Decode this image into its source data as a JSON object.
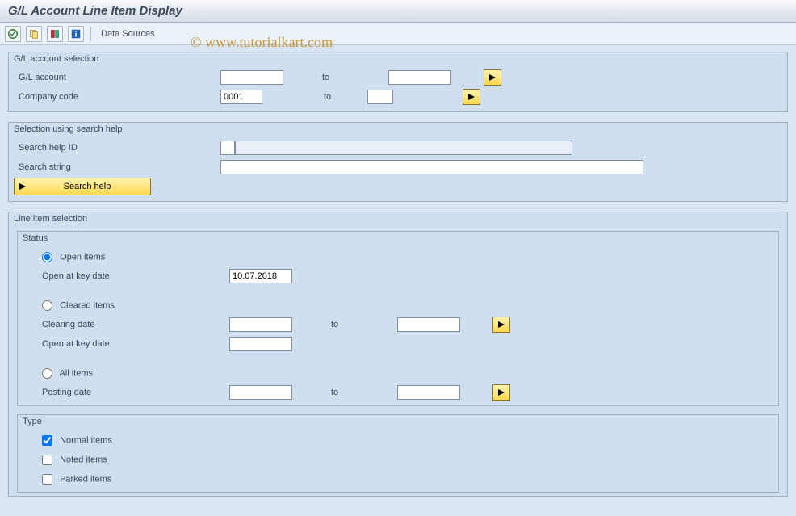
{
  "title": "G/L Account Line Item Display",
  "watermark": "© www.tutorialkart.com",
  "toolbar": {
    "data_sources_label": "Data Sources"
  },
  "gl_selection": {
    "group_title": "G/L account selection",
    "gl_account_label": "G/L account",
    "gl_account_from": "",
    "gl_account_to": "",
    "company_code_label": "Company code",
    "company_code_from": "0001",
    "company_code_to": "",
    "to_label": "to"
  },
  "search_help": {
    "group_title": "Selection using search help",
    "id_label": "Search help ID",
    "id_value": "",
    "id_desc": "",
    "string_label": "Search string",
    "string_value": "",
    "btn_label": "Search help"
  },
  "line_item": {
    "group_title": "Line item selection",
    "status": {
      "title": "Status",
      "open_items_label": "Open items",
      "open_key_date_label": "Open at key date",
      "open_key_date_value": "10.07.2018",
      "cleared_items_label": "Cleared items",
      "clearing_date_label": "Clearing date",
      "clearing_date_from": "",
      "clearing_date_to": "",
      "cleared_key_date_label": "Open at key date",
      "cleared_key_date_value": "",
      "all_items_label": "All items",
      "posting_date_label": "Posting date",
      "posting_date_from": "",
      "posting_date_to": "",
      "to_label": "to",
      "selected": "open"
    },
    "type": {
      "title": "Type",
      "normal_label": "Normal items",
      "normal_checked": true,
      "noted_label": "Noted items",
      "noted_checked": false,
      "parked_label": "Parked items",
      "parked_checked": false
    }
  }
}
